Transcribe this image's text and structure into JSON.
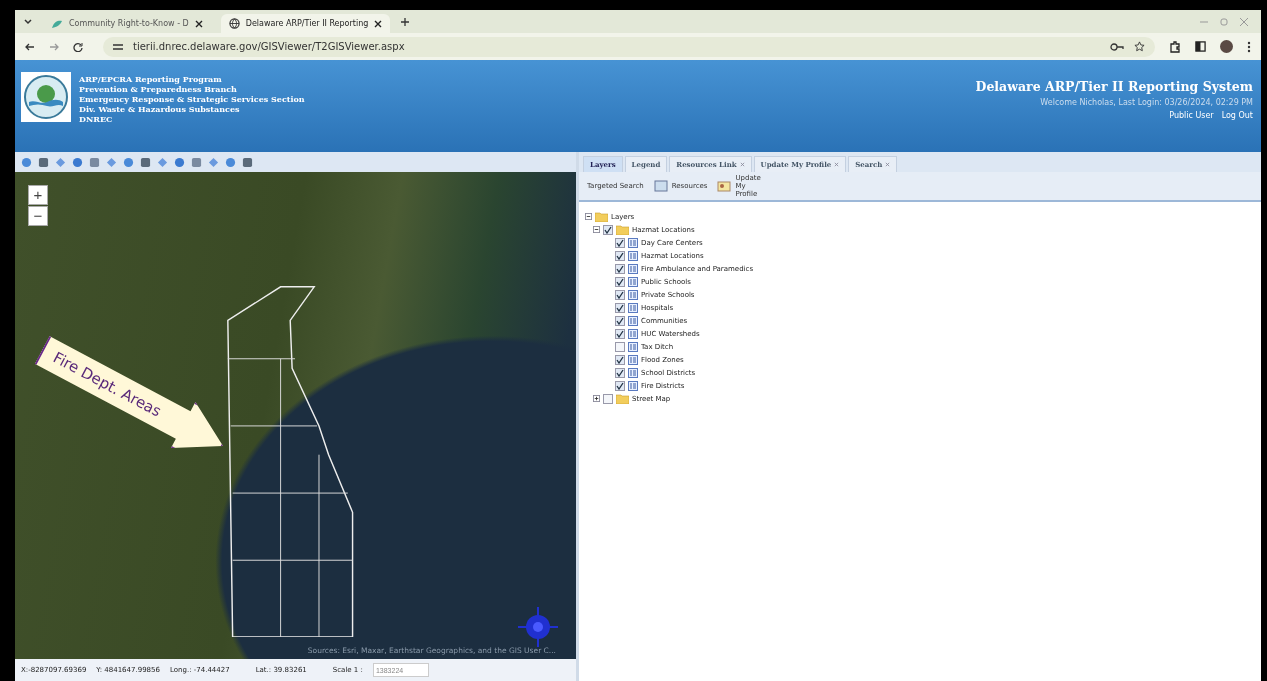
{
  "browser": {
    "tabs": [
      {
        "title": "Community Right-to-Know - D",
        "selected": false
      },
      {
        "title": "Delaware ARP/Tier II Reporting",
        "selected": true
      }
    ],
    "url": "tierii.dnrec.delaware.gov/GISViewer/T2GISViewer.aspx"
  },
  "header": {
    "org_lines": [
      "ARP/EPCRA Reporting Program",
      "Prevention & Preparedness Branch",
      "Emergency Response & Strategic Services Section",
      "Div. Waste & Hazardous Substances",
      "DNREC"
    ],
    "title": "Delaware ARP/Tier II Reporting System",
    "welcome": "Welcome  Nicholas, Last Login: 03/26/2024, 02:29 PM",
    "links": [
      "Public User",
      "Log Out"
    ]
  },
  "map": {
    "zoom_in": "+",
    "zoom_out": "−",
    "annotation": "Fire Dept. Areas",
    "attribution": "Sources: Esri, Maxar, Earthstar Geographics, and the GIS User C..."
  },
  "status_bar": {
    "x": "X:-8287097.69369",
    "y": "Y:  4841647.99856",
    "long": "Long.: -74.44427",
    "lat": "Lat.:  39.83261",
    "scale_label": "Scale 1 :",
    "scale_value": "1383224"
  },
  "panel": {
    "tabs": [
      {
        "label": "Layers",
        "selected": true,
        "closable": false
      },
      {
        "label": "Legend",
        "selected": false,
        "closable": false
      },
      {
        "label": "Resources Link",
        "selected": false,
        "closable": true
      },
      {
        "label": "Update My Profile",
        "selected": false,
        "closable": true
      },
      {
        "label": "Search",
        "selected": false,
        "closable": true
      }
    ],
    "toolbar": [
      "Targeted Search",
      "Resources",
      "Update My Profile"
    ],
    "tree": {
      "label": "Layers",
      "expanded": true,
      "children": [
        {
          "label": "Hazmat Locations",
          "checked": true,
          "expanded": true,
          "children": [
            {
              "label": "Day Care Centers",
              "checked": true
            },
            {
              "label": "Hazmat Locations",
              "checked": true
            },
            {
              "label": "Fire Ambulance and Paramedics",
              "checked": true
            },
            {
              "label": "Public Schools",
              "checked": true
            },
            {
              "label": "Private Schools",
              "checked": true
            },
            {
              "label": "Hospitals",
              "checked": true
            },
            {
              "label": "Communities",
              "checked": true
            },
            {
              "label": "HUC Watersheds",
              "checked": true
            },
            {
              "label": "Tax Ditch",
              "checked": false
            },
            {
              "label": "Flood Zones",
              "checked": true
            },
            {
              "label": "School Districts",
              "checked": true
            },
            {
              "label": "Fire Districts",
              "checked": true
            }
          ]
        },
        {
          "label": "Street Map",
          "checked": false,
          "expanded": false
        }
      ]
    }
  }
}
